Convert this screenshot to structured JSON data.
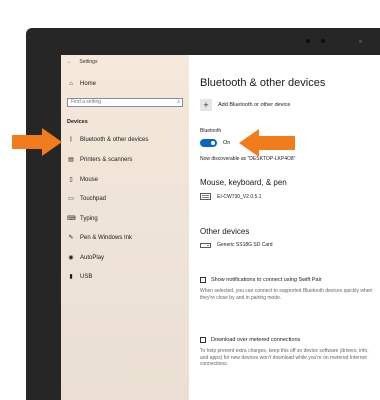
{
  "window": {
    "title": "Settings"
  },
  "sidebar": {
    "home_label": "Home",
    "search_placeholder": "Find a setting",
    "section_label": "Devices",
    "items": [
      {
        "label": "Bluetooth & other devices",
        "icon": "bluetooth-icon"
      },
      {
        "label": "Printers & scanners",
        "icon": "printer-icon"
      },
      {
        "label": "Mouse",
        "icon": "mouse-icon"
      },
      {
        "label": "Touchpad",
        "icon": "touchpad-icon"
      },
      {
        "label": "Typing",
        "icon": "keyboard-icon"
      },
      {
        "label": "Pen & Windows Ink",
        "icon": "pen-icon"
      },
      {
        "label": "AutoPlay",
        "icon": "autoplay-icon"
      },
      {
        "label": "USB",
        "icon": "usb-icon"
      }
    ]
  },
  "main": {
    "title": "Bluetooth & other devices",
    "add_device_label": "Add Bluetooth or other device",
    "bluetooth_label": "Bluetooth",
    "toggle_state": "On",
    "discoverable_text": "Now discoverable as \"DESKTOP-LKP4O8\"",
    "mouse_section": {
      "heading": "Mouse, keyboard, & pen",
      "device": "EI-CW730_V2.0.5.1"
    },
    "other_section": {
      "heading": "Other devices",
      "device": "Generic SS18G SD Card"
    },
    "swift_pair": {
      "label": "Show notifications to connect using Swift Pair",
      "description": "When selected, you can connect to supported Bluetooth devices quickly when they're close by and in pairing mode."
    },
    "metered": {
      "label": "Download over metered connections",
      "description": "To help prevent extra charges, keep this off so device software (drivers, info, and apps) for new devices won't download while you're on metered Internet connections."
    }
  },
  "colors": {
    "accent": "#0a66c2",
    "arrow": "#f07c1b",
    "bezel": "#262626"
  }
}
